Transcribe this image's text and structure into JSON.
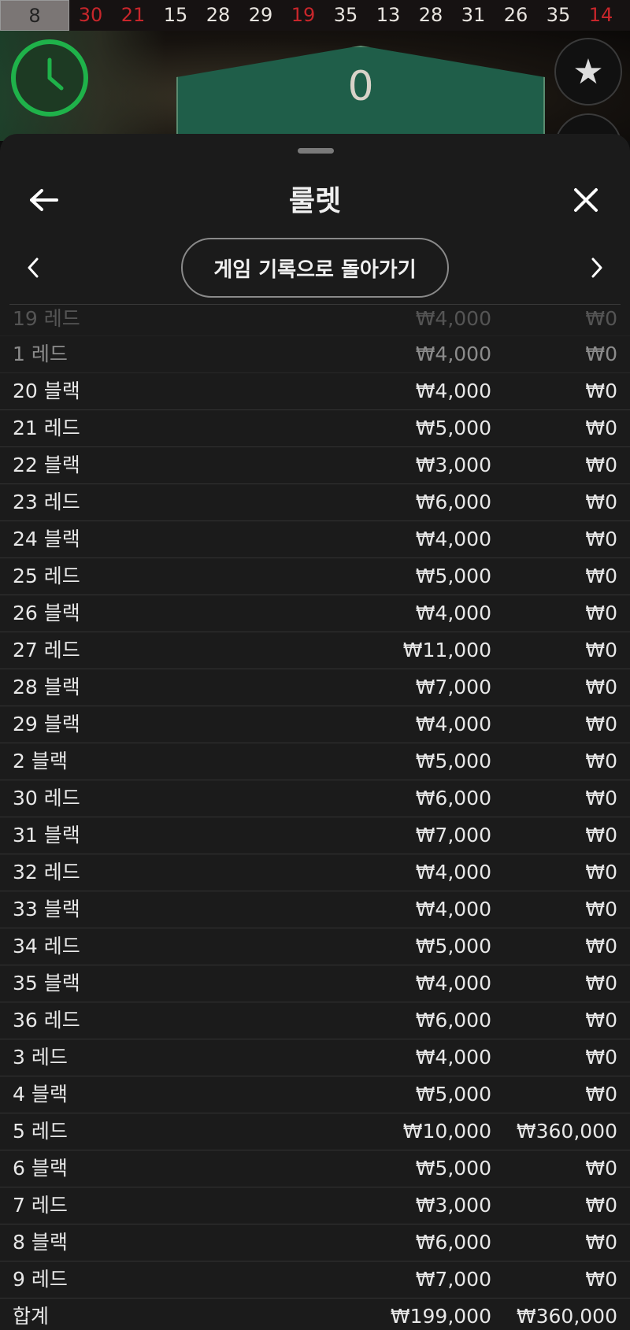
{
  "results_strip": [
    {
      "value": "8",
      "color": "current"
    },
    {
      "value": "30",
      "color": "red"
    },
    {
      "value": "21",
      "color": "red"
    },
    {
      "value": "15",
      "color": "black"
    },
    {
      "value": "28",
      "color": "black"
    },
    {
      "value": "29",
      "color": "black"
    },
    {
      "value": "19",
      "color": "red"
    },
    {
      "value": "35",
      "color": "black"
    },
    {
      "value": "13",
      "color": "black"
    },
    {
      "value": "28",
      "color": "black"
    },
    {
      "value": "31",
      "color": "black"
    },
    {
      "value": "26",
      "color": "black"
    },
    {
      "value": "35",
      "color": "black"
    },
    {
      "value": "14",
      "color": "red"
    }
  ],
  "game": {
    "board_number": "0",
    "favorite_icon": "star-icon",
    "timer_icon": "clock-icon"
  },
  "sheet": {
    "title": "룰렛",
    "back_icon": "arrow-left-icon",
    "close_icon": "close-icon",
    "back_to_history_label": "게임 기록으로 돌아가기",
    "prev_icon": "chevron-left-icon",
    "next_icon": "chevron-right-icon"
  },
  "table": {
    "rows": [
      {
        "bet": "19 레드",
        "stake": "₩4,000",
        "payout": "₩0"
      },
      {
        "bet": "1 레드",
        "stake": "₩4,000",
        "payout": "₩0"
      },
      {
        "bet": "20 블랙",
        "stake": "₩4,000",
        "payout": "₩0"
      },
      {
        "bet": "21 레드",
        "stake": "₩5,000",
        "payout": "₩0"
      },
      {
        "bet": "22 블랙",
        "stake": "₩3,000",
        "payout": "₩0"
      },
      {
        "bet": "23 레드",
        "stake": "₩6,000",
        "payout": "₩0"
      },
      {
        "bet": "24 블랙",
        "stake": "₩4,000",
        "payout": "₩0"
      },
      {
        "bet": "25 레드",
        "stake": "₩5,000",
        "payout": "₩0"
      },
      {
        "bet": "26 블랙",
        "stake": "₩4,000",
        "payout": "₩0"
      },
      {
        "bet": "27 레드",
        "stake": "₩11,000",
        "payout": "₩0"
      },
      {
        "bet": "28 블랙",
        "stake": "₩7,000",
        "payout": "₩0"
      },
      {
        "bet": "29 블랙",
        "stake": "₩4,000",
        "payout": "₩0"
      },
      {
        "bet": "2 블랙",
        "stake": "₩5,000",
        "payout": "₩0"
      },
      {
        "bet": "30 레드",
        "stake": "₩6,000",
        "payout": "₩0"
      },
      {
        "bet": "31 블랙",
        "stake": "₩7,000",
        "payout": "₩0"
      },
      {
        "bet": "32 레드",
        "stake": "₩4,000",
        "payout": "₩0"
      },
      {
        "bet": "33 블랙",
        "stake": "₩4,000",
        "payout": "₩0"
      },
      {
        "bet": "34 레드",
        "stake": "₩5,000",
        "payout": "₩0"
      },
      {
        "bet": "35 블랙",
        "stake": "₩4,000",
        "payout": "₩0"
      },
      {
        "bet": "36 레드",
        "stake": "₩6,000",
        "payout": "₩0"
      },
      {
        "bet": "3 레드",
        "stake": "₩4,000",
        "payout": "₩0"
      },
      {
        "bet": "4 블랙",
        "stake": "₩5,000",
        "payout": "₩0"
      },
      {
        "bet": "5 레드",
        "stake": "₩10,000",
        "payout": "₩360,000"
      },
      {
        "bet": "6 블랙",
        "stake": "₩5,000",
        "payout": "₩0"
      },
      {
        "bet": "7 레드",
        "stake": "₩3,000",
        "payout": "₩0"
      },
      {
        "bet": "8 블랙",
        "stake": "₩6,000",
        "payout": "₩0"
      },
      {
        "bet": "9 레드",
        "stake": "₩7,000",
        "payout": "₩0"
      }
    ],
    "total": {
      "label": "합계",
      "stake": "₩199,000",
      "payout": "₩360,000"
    }
  },
  "colors": {
    "red_number": "#c8262b",
    "sheet_bg": "#1b1b1b",
    "timer_green": "#1fb24a",
    "board_green": "#1f5e49"
  }
}
